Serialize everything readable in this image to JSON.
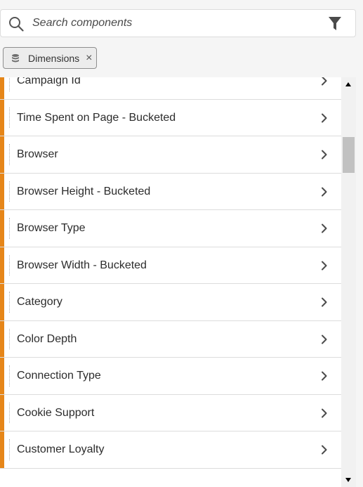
{
  "search": {
    "placeholder": "Search components",
    "value": ""
  },
  "filter_tag": {
    "label": "Dimensions",
    "close_symbol": "×",
    "icon": "dimension-stack-icon"
  },
  "colors": {
    "accent": "#e68619",
    "row_border": "#dcdcdc"
  },
  "list": {
    "items": [
      {
        "label": "Campaign Id"
      },
      {
        "label": "Time Spent on Page - Bucketed"
      },
      {
        "label": "Browser"
      },
      {
        "label": "Browser Height - Bucketed"
      },
      {
        "label": "Browser Type"
      },
      {
        "label": "Browser Width - Bucketed"
      },
      {
        "label": "Category"
      },
      {
        "label": "Color Depth"
      },
      {
        "label": "Connection Type"
      },
      {
        "label": "Cookie Support"
      },
      {
        "label": "Customer Loyalty"
      }
    ]
  }
}
